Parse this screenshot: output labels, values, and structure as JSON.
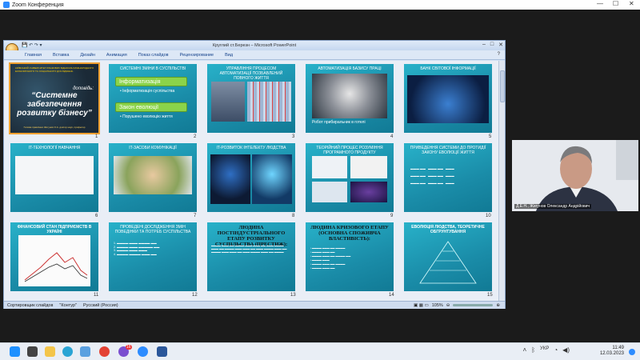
{
  "zoom": {
    "title": "Zoom Конференция"
  },
  "ppt": {
    "title": "Круглий ст.Березн – Microsoft PowerPoint",
    "tabs": [
      "Главная",
      "Вставка",
      "Дизайн",
      "Анимация",
      "Показ слайдов",
      "Рецензирование",
      "Вид"
    ],
    "status": {
      "view": "Сортировщик слайдов",
      "theme": "\"Контур\"",
      "lang": "Русский (Россия)",
      "zoom": "105%"
    }
  },
  "slides": [
    {
      "num": "1",
      "header": "КИЇВСЬКИЙ УНІВЕРСИТЕТ РИНКОВИХ ВІДНОСИН МІЖНАРОДНОГО ЕКОНОМІЧНОГО ТА СОЦІАЛЬНОГО ДОСЛІДЖЕНЬ",
      "label": "доповідь:",
      "title": "“Системне забезпечення розвитку бізнесу”",
      "author": "Голова правління Жигунов О.А. доктор наук, професор"
    },
    {
      "num": "2",
      "title": "СИСТЕМНІ ЗМІНИ В СУСПІЛЬСТВІ",
      "box1": "Інформатизація",
      "b1": "Інформатизація суспільства",
      "box2": "Закон еволюції",
      "b2": "Порушено еволюцію життя"
    },
    {
      "num": "3",
      "title": "УПРАВЛІННЯ ПРОЦЕСОМ АВТОМАТИЗАЦІЇ ПОЗБАВЛЕНИЙ ПОВНОГО ЖИТТЯ"
    },
    {
      "num": "4",
      "title": "АВТОМАТИЗАЦІЯ БАЗИСУ ПРАЦІ",
      "caption": "Робот прибиральник в готелі"
    },
    {
      "num": "5",
      "title": "БАНК СВІТОВОЇ ІНФОРМАЦІЇ"
    },
    {
      "num": "6",
      "title": "IT-ТЕХНОЛОГІЇ НАВЧАННЯ"
    },
    {
      "num": "7",
      "title": "IT-ЗАСОБИ КОМУНІКАЦІЇ"
    },
    {
      "num": "8",
      "title": "IT-РОЗВИТОК ІНТЕЛЕКТУ ЛЮДСТВА"
    },
    {
      "num": "9",
      "title": "ТЕОРІЙНИЙ ПРОЦЕС РОЗУМІННЯ ПРОГРАМНОГО ПРОДУКТУ"
    },
    {
      "num": "10",
      "title": "ПРИВЕДЕННЯ СИСТЕМИ ДО ПРОТИДІЇ ЗАКОНУ ЕВОЛЮЦІЇ ЖИТТЯ"
    },
    {
      "num": "11",
      "title": "ФІНАНСОВИЙ СТАН ПІДПРИЄМСТВ В УКРАЇНІ"
    },
    {
      "num": "12",
      "title": "ПРОВЕДЕНІ ДОСЛІДЖЕННЯ ЗМІН ПОВЕДІНКИ ТА ПОТРЕБ СУСПІЛЬСТВА"
    },
    {
      "num": "13",
      "title": "ЛЮДИНА ПОСТІНДУСТРІАЛЬНОГО ЕТАПУ РОЗВИТКУ СУСПІЛЬСТВА (ПРЕСТИЖ):"
    },
    {
      "num": "14",
      "title": "ЛЮДИНА КРИЗОВОГО ЕТАПУ (ОСНОВНА СПОЖИВЧА ВЛАСТИВІСТЬ):"
    },
    {
      "num": "15",
      "title": "ЕВОЛЮЦІЯ ЛЮДСТВА, ТЕОРЕТИЧНЕ ОБГРУНТУВАННЯ"
    }
  ],
  "cam": {
    "label": "Д.Е.Н., Жигунов Олександр Андрійович"
  },
  "taskbar": {
    "lang": "УКР",
    "time": "11:49",
    "date": "12.03.2023",
    "badge": "16"
  }
}
